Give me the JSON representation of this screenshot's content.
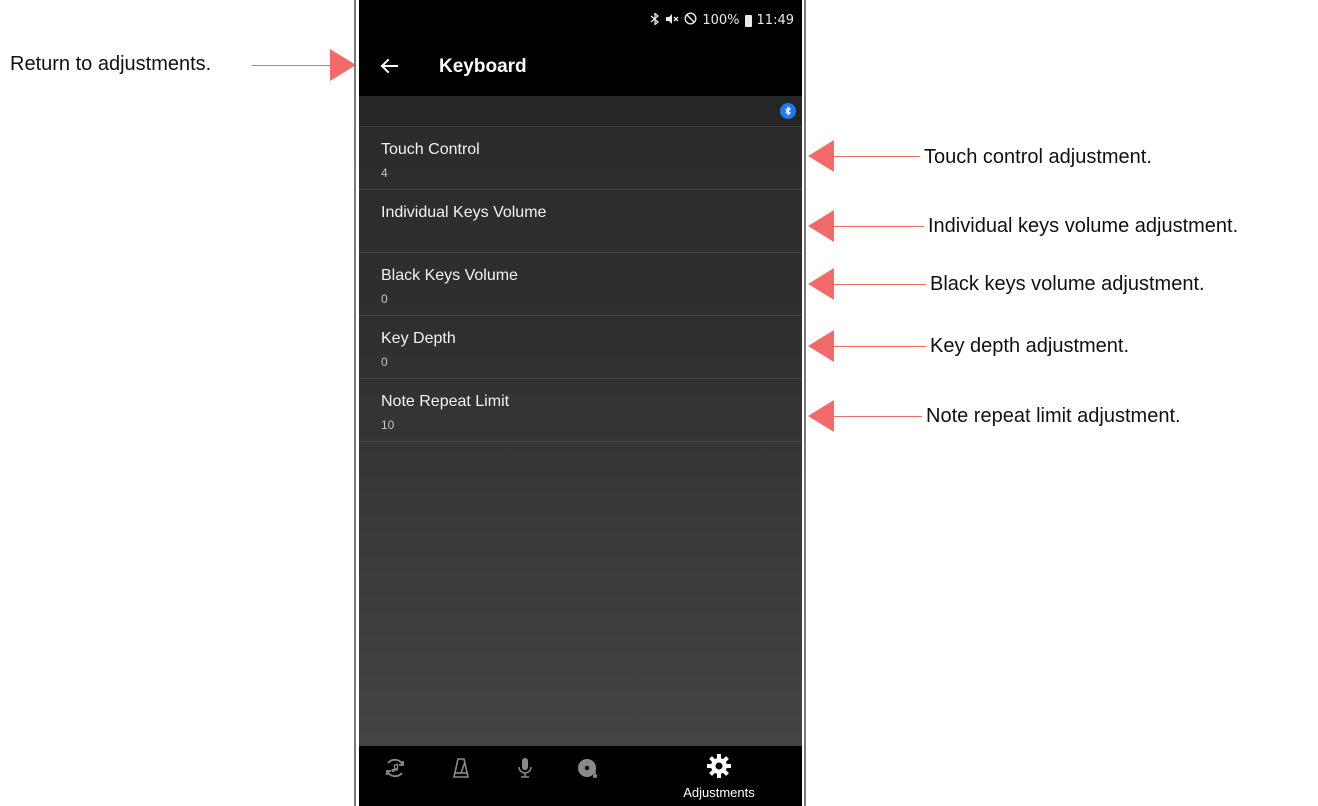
{
  "annotations": {
    "return": "Return to adjustments.",
    "touch_control": "Touch control adjustment.",
    "individual_keys": "Individual keys volume adjustment.",
    "black_keys": "Black keys volume adjustment.",
    "key_depth": "Key depth adjustment.",
    "note_repeat": "Note repeat limit adjustment."
  },
  "status_bar": {
    "battery": "100%",
    "time": "11:49"
  },
  "app_bar": {
    "title": "Keyboard"
  },
  "settings": [
    {
      "title": "Touch Control",
      "value": "4"
    },
    {
      "title": "Individual Keys Volume",
      "value": ""
    },
    {
      "title": "Black Keys Volume",
      "value": "0"
    },
    {
      "title": "Key Depth",
      "value": "0"
    },
    {
      "title": "Note Repeat Limit",
      "value": "10"
    }
  ],
  "bottom_nav": {
    "items": [
      {
        "icon": "music-loop-icon",
        "label": ""
      },
      {
        "icon": "metronome-icon",
        "label": ""
      },
      {
        "icon": "microphone-icon",
        "label": ""
      },
      {
        "icon": "record-disc-icon",
        "label": ""
      },
      {
        "icon": "gear-icon",
        "label": "Adjustments"
      }
    ]
  },
  "colors": {
    "accent_arrow": "#f26b6b",
    "bluetooth_badge": "#1a7cf0",
    "app_bar": "#000000"
  }
}
